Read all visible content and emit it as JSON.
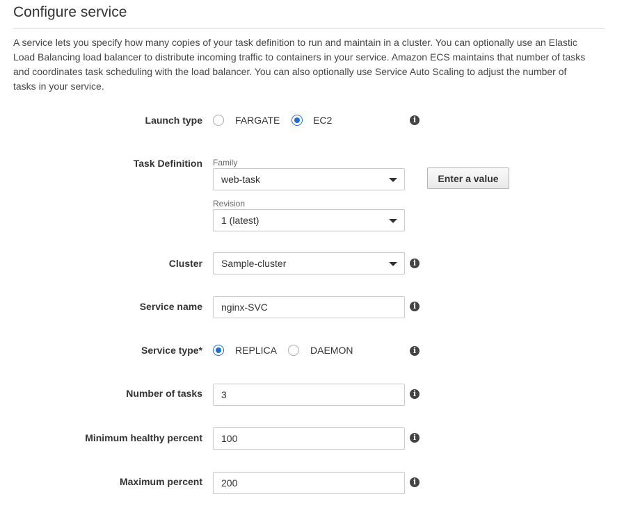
{
  "page": {
    "title": "Configure service",
    "description": "A service lets you specify how many copies of your task definition to run and maintain in a cluster. You can optionally use an Elastic Load Balancing load balancer to distribute incoming traffic to containers in your service. Amazon ECS maintains that number of tasks and coordinates task scheduling with the load balancer. You can also optionally use Service Auto Scaling to adjust the number of tasks in your service."
  },
  "launch_type": {
    "label": "Launch type",
    "options": [
      {
        "label": "FARGATE",
        "selected": false
      },
      {
        "label": "EC2",
        "selected": true
      }
    ]
  },
  "task_definition": {
    "label": "Task Definition",
    "family_label": "Family",
    "family_value": "web-task",
    "revision_label": "Revision",
    "revision_value": "1 (latest)",
    "enter_value_button": "Enter a value"
  },
  "cluster": {
    "label": "Cluster",
    "value": "Sample-cluster"
  },
  "service_name": {
    "label": "Service name",
    "value": "nginx-SVC"
  },
  "service_type": {
    "label": "Service type*",
    "options": [
      {
        "label": "REPLICA",
        "selected": true
      },
      {
        "label": "DAEMON",
        "selected": false
      }
    ]
  },
  "number_of_tasks": {
    "label": "Number of tasks",
    "value": "3"
  },
  "minimum_healthy_percent": {
    "label": "Minimum healthy percent",
    "value": "100"
  },
  "maximum_percent": {
    "label": "Maximum percent",
    "value": "200"
  },
  "icons": {
    "info": "info-icon",
    "info_glyph": "i",
    "dropdown": "caret-down-icon"
  },
  "colors": {
    "radio_selected": "#1f6fd0",
    "info_icon": "#444444"
  }
}
